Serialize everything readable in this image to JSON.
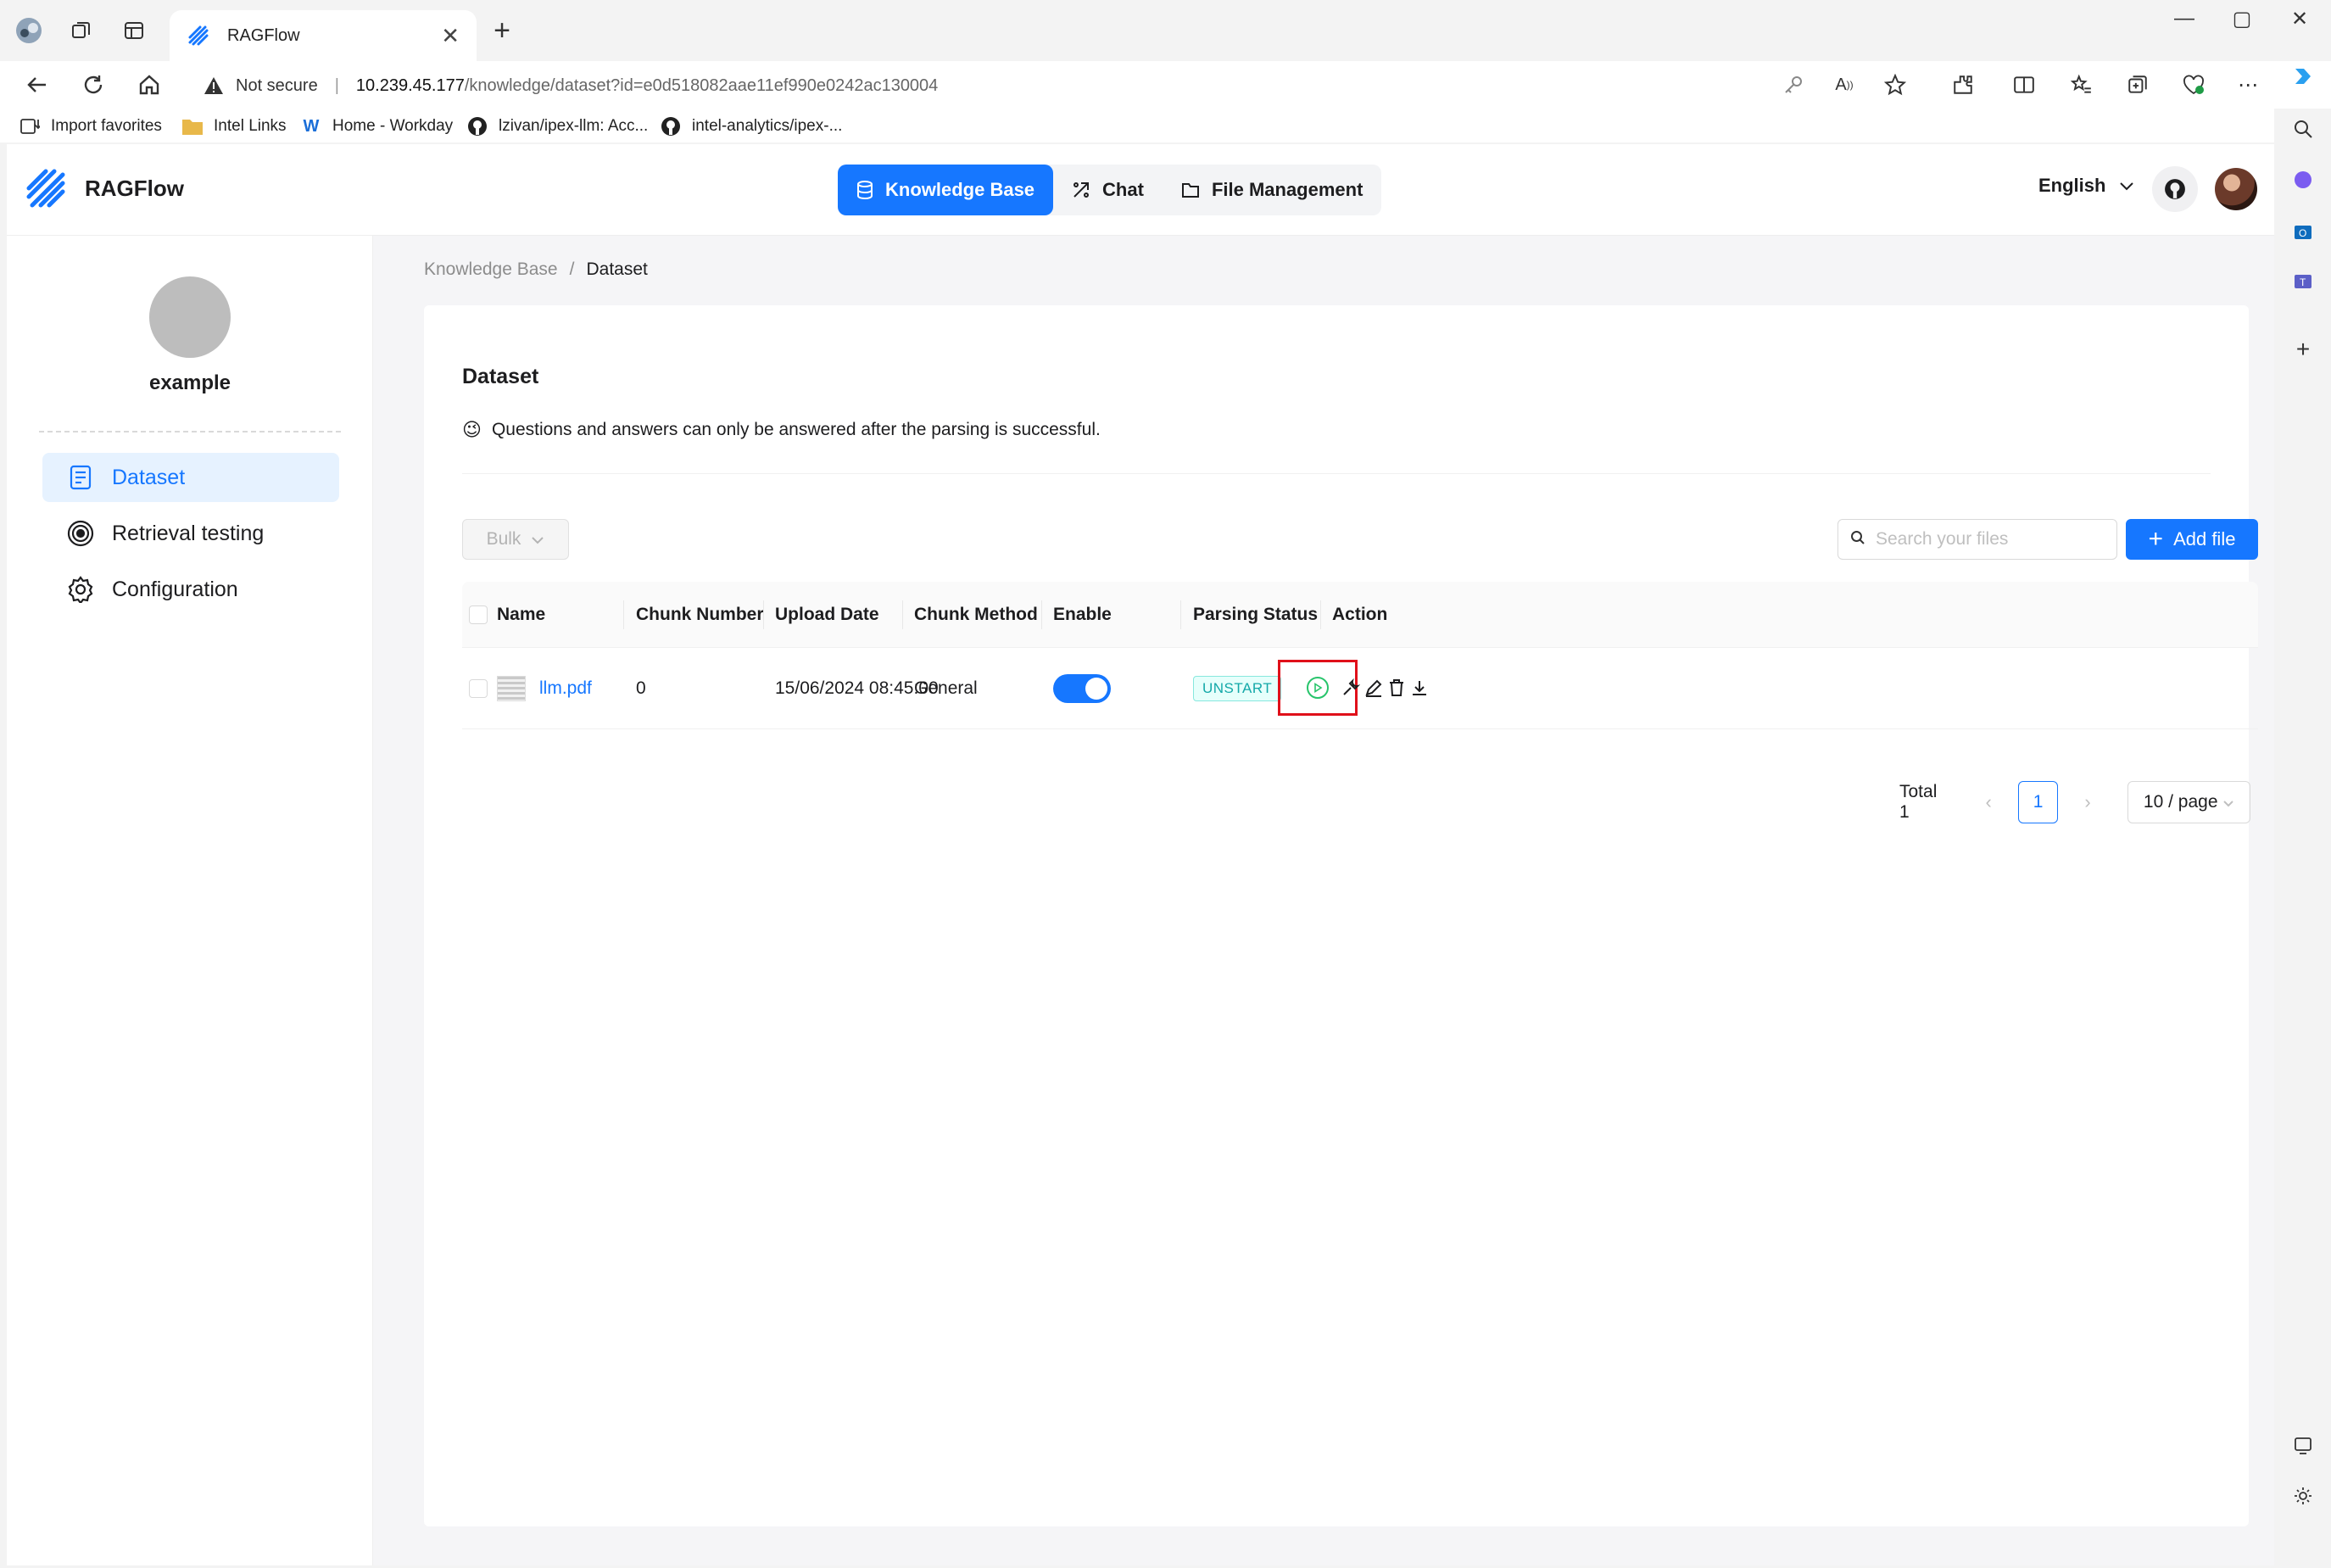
{
  "browser": {
    "tab_title": "RAGFlow",
    "url_warning": "Not secure",
    "url_host": "10.239.45.177",
    "url_path": "/knowledge/dataset?id=e0d518082aae11ef990e0242ac130004",
    "favorites": [
      {
        "label": "Import favorites"
      },
      {
        "label": "Intel Links"
      },
      {
        "label": "Home - Workday"
      },
      {
        "label": "lzivan/ipex-llm: Acc..."
      },
      {
        "label": "intel-analytics/ipex-..."
      }
    ]
  },
  "app": {
    "name": "RAGFlow",
    "nav": [
      {
        "label": "Knowledge Base",
        "icon": "database-icon",
        "active": true
      },
      {
        "label": "Chat",
        "icon": "chat-icon",
        "active": false
      },
      {
        "label": "File Management",
        "icon": "folder-icon",
        "active": false
      }
    ],
    "language": "English",
    "accent_color": "#1677ff"
  },
  "sidebar": {
    "kb_name": "example",
    "items": [
      {
        "label": "Dataset",
        "icon": "document-icon",
        "active": true
      },
      {
        "label": "Retrieval testing",
        "icon": "target-icon",
        "active": false
      },
      {
        "label": "Configuration",
        "icon": "gear-icon",
        "active": false
      }
    ]
  },
  "breadcrumb": {
    "root": "Knowledge Base",
    "current": "Dataset"
  },
  "dataset": {
    "title": "Dataset",
    "hint_emoji": "😉",
    "hint": "Questions and answers can only be answered after the parsing is successful.",
    "bulk_label": "Bulk",
    "search_placeholder": "Search your files",
    "add_file_label": "Add file",
    "columns": [
      "Name",
      "Chunk Number",
      "Upload Date",
      "Chunk Method",
      "Enable",
      "Parsing Status",
      "Action"
    ],
    "rows": [
      {
        "name": "llm.pdf",
        "chunk_number": "0",
        "upload_date": "15/06/2024 08:45:00",
        "chunk_method": "General",
        "enabled": true,
        "parsing_status": "UNSTART"
      }
    ]
  },
  "pagination": {
    "total": "Total 1",
    "current_page": "1",
    "page_size": "10 / page"
  }
}
